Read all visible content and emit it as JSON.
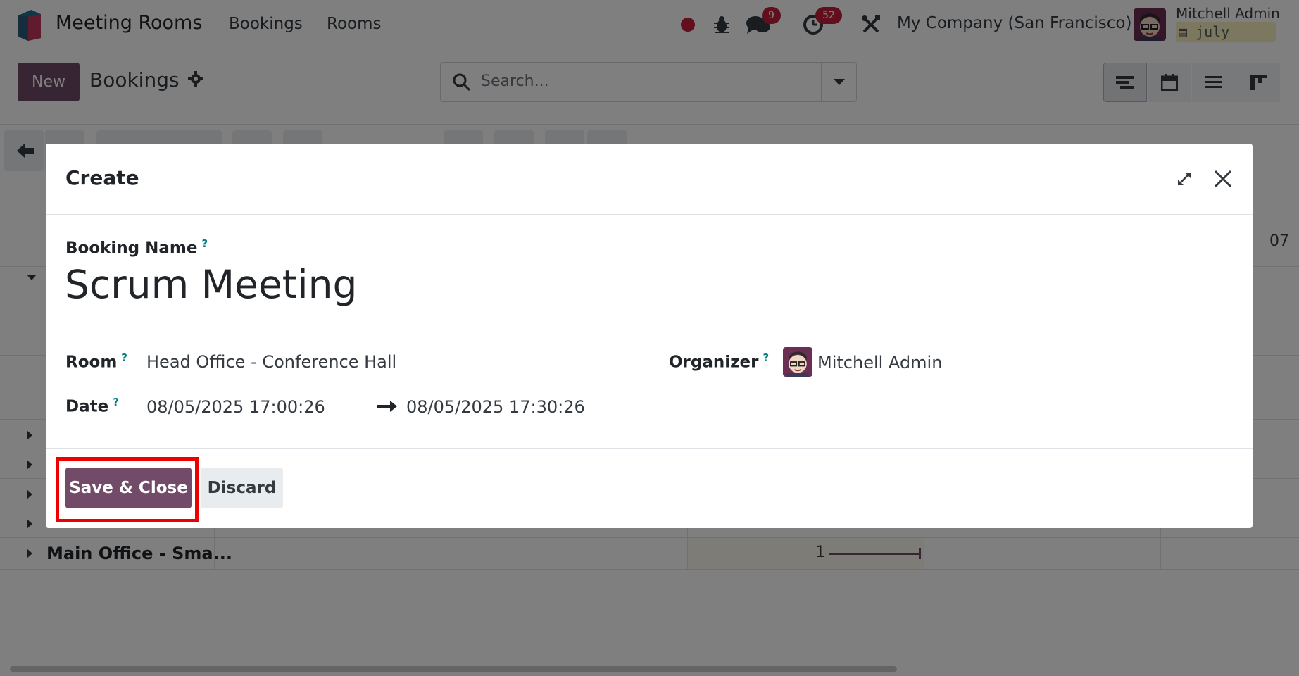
{
  "navbar": {
    "app_name": "Meeting Rooms",
    "menu": [
      "Bookings",
      "Rooms"
    ],
    "messages_count": "9",
    "activities_count": "52",
    "company": "My Company (San Francisco)",
    "user_name": "Mitchell Admin",
    "database": "july"
  },
  "control_panel": {
    "new_label": "New",
    "breadcrumb": "Bookings",
    "search_placeholder": "Search..."
  },
  "gantt": {
    "date_header": "07",
    "rows": [
      "Main Office - Sma..."
    ],
    "row_value": "1"
  },
  "modal": {
    "title": "Create",
    "fields": {
      "booking_name_label": "Booking Name",
      "booking_name_value": "Scrum Meeting",
      "room_label": "Room",
      "room_value": "Head Office - Conference Hall",
      "date_label": "Date",
      "date_start": "08/05/2025 17:00:26",
      "date_end": "08/05/2025 17:30:26",
      "organizer_label": "Organizer",
      "organizer_value": "Mitchell Admin",
      "help_mark": "?"
    },
    "footer": {
      "save_label": "Save & Close",
      "discard_label": "Discard"
    }
  },
  "colors": {
    "primary": "#714b67",
    "badge": "#c41e3a",
    "highlight": "#ee0000"
  }
}
